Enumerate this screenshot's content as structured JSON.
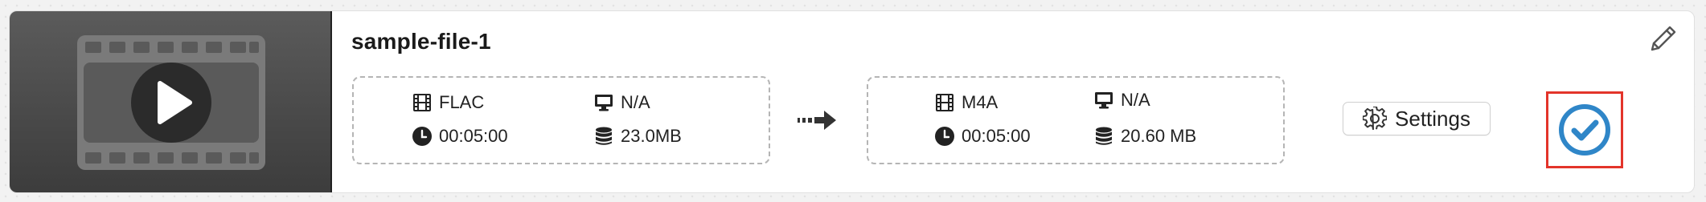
{
  "file": {
    "name": "sample-file-1"
  },
  "source": {
    "format": "FLAC",
    "resolution": "N/A",
    "duration": "00:05:00",
    "size": "23.0MB"
  },
  "target": {
    "format": "M4A",
    "resolution": "N/A",
    "duration": "00:05:00",
    "size": "20.60 MB"
  },
  "actions": {
    "settings_label": "Settings",
    "checked": true
  },
  "icons": {
    "thumbnail": "video-play-icon",
    "edit": "pencil-icon",
    "format": "film-icon",
    "resolution": "monitor-icon",
    "duration": "clock-icon",
    "size": "database-icon",
    "convert": "arrow-right-icon",
    "settings": "gear-icon",
    "status": "check-circle-icon"
  },
  "colors": {
    "accent": "#2f86c8",
    "highlight_border": "#e3342a"
  }
}
